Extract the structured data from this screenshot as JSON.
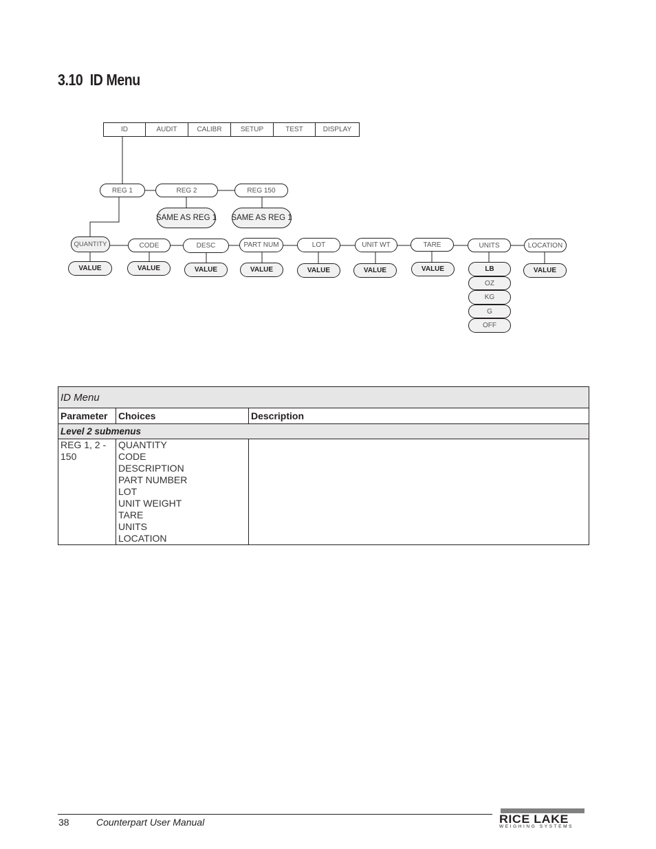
{
  "heading": {
    "number": "3.10",
    "title": "ID Menu"
  },
  "menubar": [
    "ID",
    "AUDIT",
    "CALIBR",
    "SETUP",
    "TEST",
    "DISPLAY"
  ],
  "regs": [
    "REG 1",
    "REG 2",
    "REG 150"
  ],
  "same_as": [
    "SAME AS REG 1",
    "SAME AS REG 1"
  ],
  "params": [
    "QUANTITY",
    "CODE",
    "DESC",
    "PART NUM",
    "LOT",
    "UNIT WT",
    "TARE",
    "UNITS",
    "LOCATION"
  ],
  "value_label": "VALUE",
  "units_options": [
    "LB",
    "OZ",
    "KG",
    "G",
    "OFF"
  ],
  "table": {
    "title": "ID Menu",
    "headers": [
      "Parameter",
      "Choices",
      "Description"
    ],
    "section": "Level 2 submenus",
    "rows": [
      {
        "parameter": "REG 1, 2 - 150",
        "choices": [
          "QUANTITY",
          "CODE",
          "DESCRIPTION",
          "PART NUMBER",
          "LOT",
          "UNIT WEIGHT",
          "TARE",
          "UNITS",
          "LOCATION"
        ],
        "description": ""
      }
    ]
  },
  "footer": {
    "page_number": "38",
    "manual_title": "Counterpart User Manual",
    "logo_name": "RICE LAKE",
    "logo_sub": "WEIGHING SYSTEMS"
  }
}
